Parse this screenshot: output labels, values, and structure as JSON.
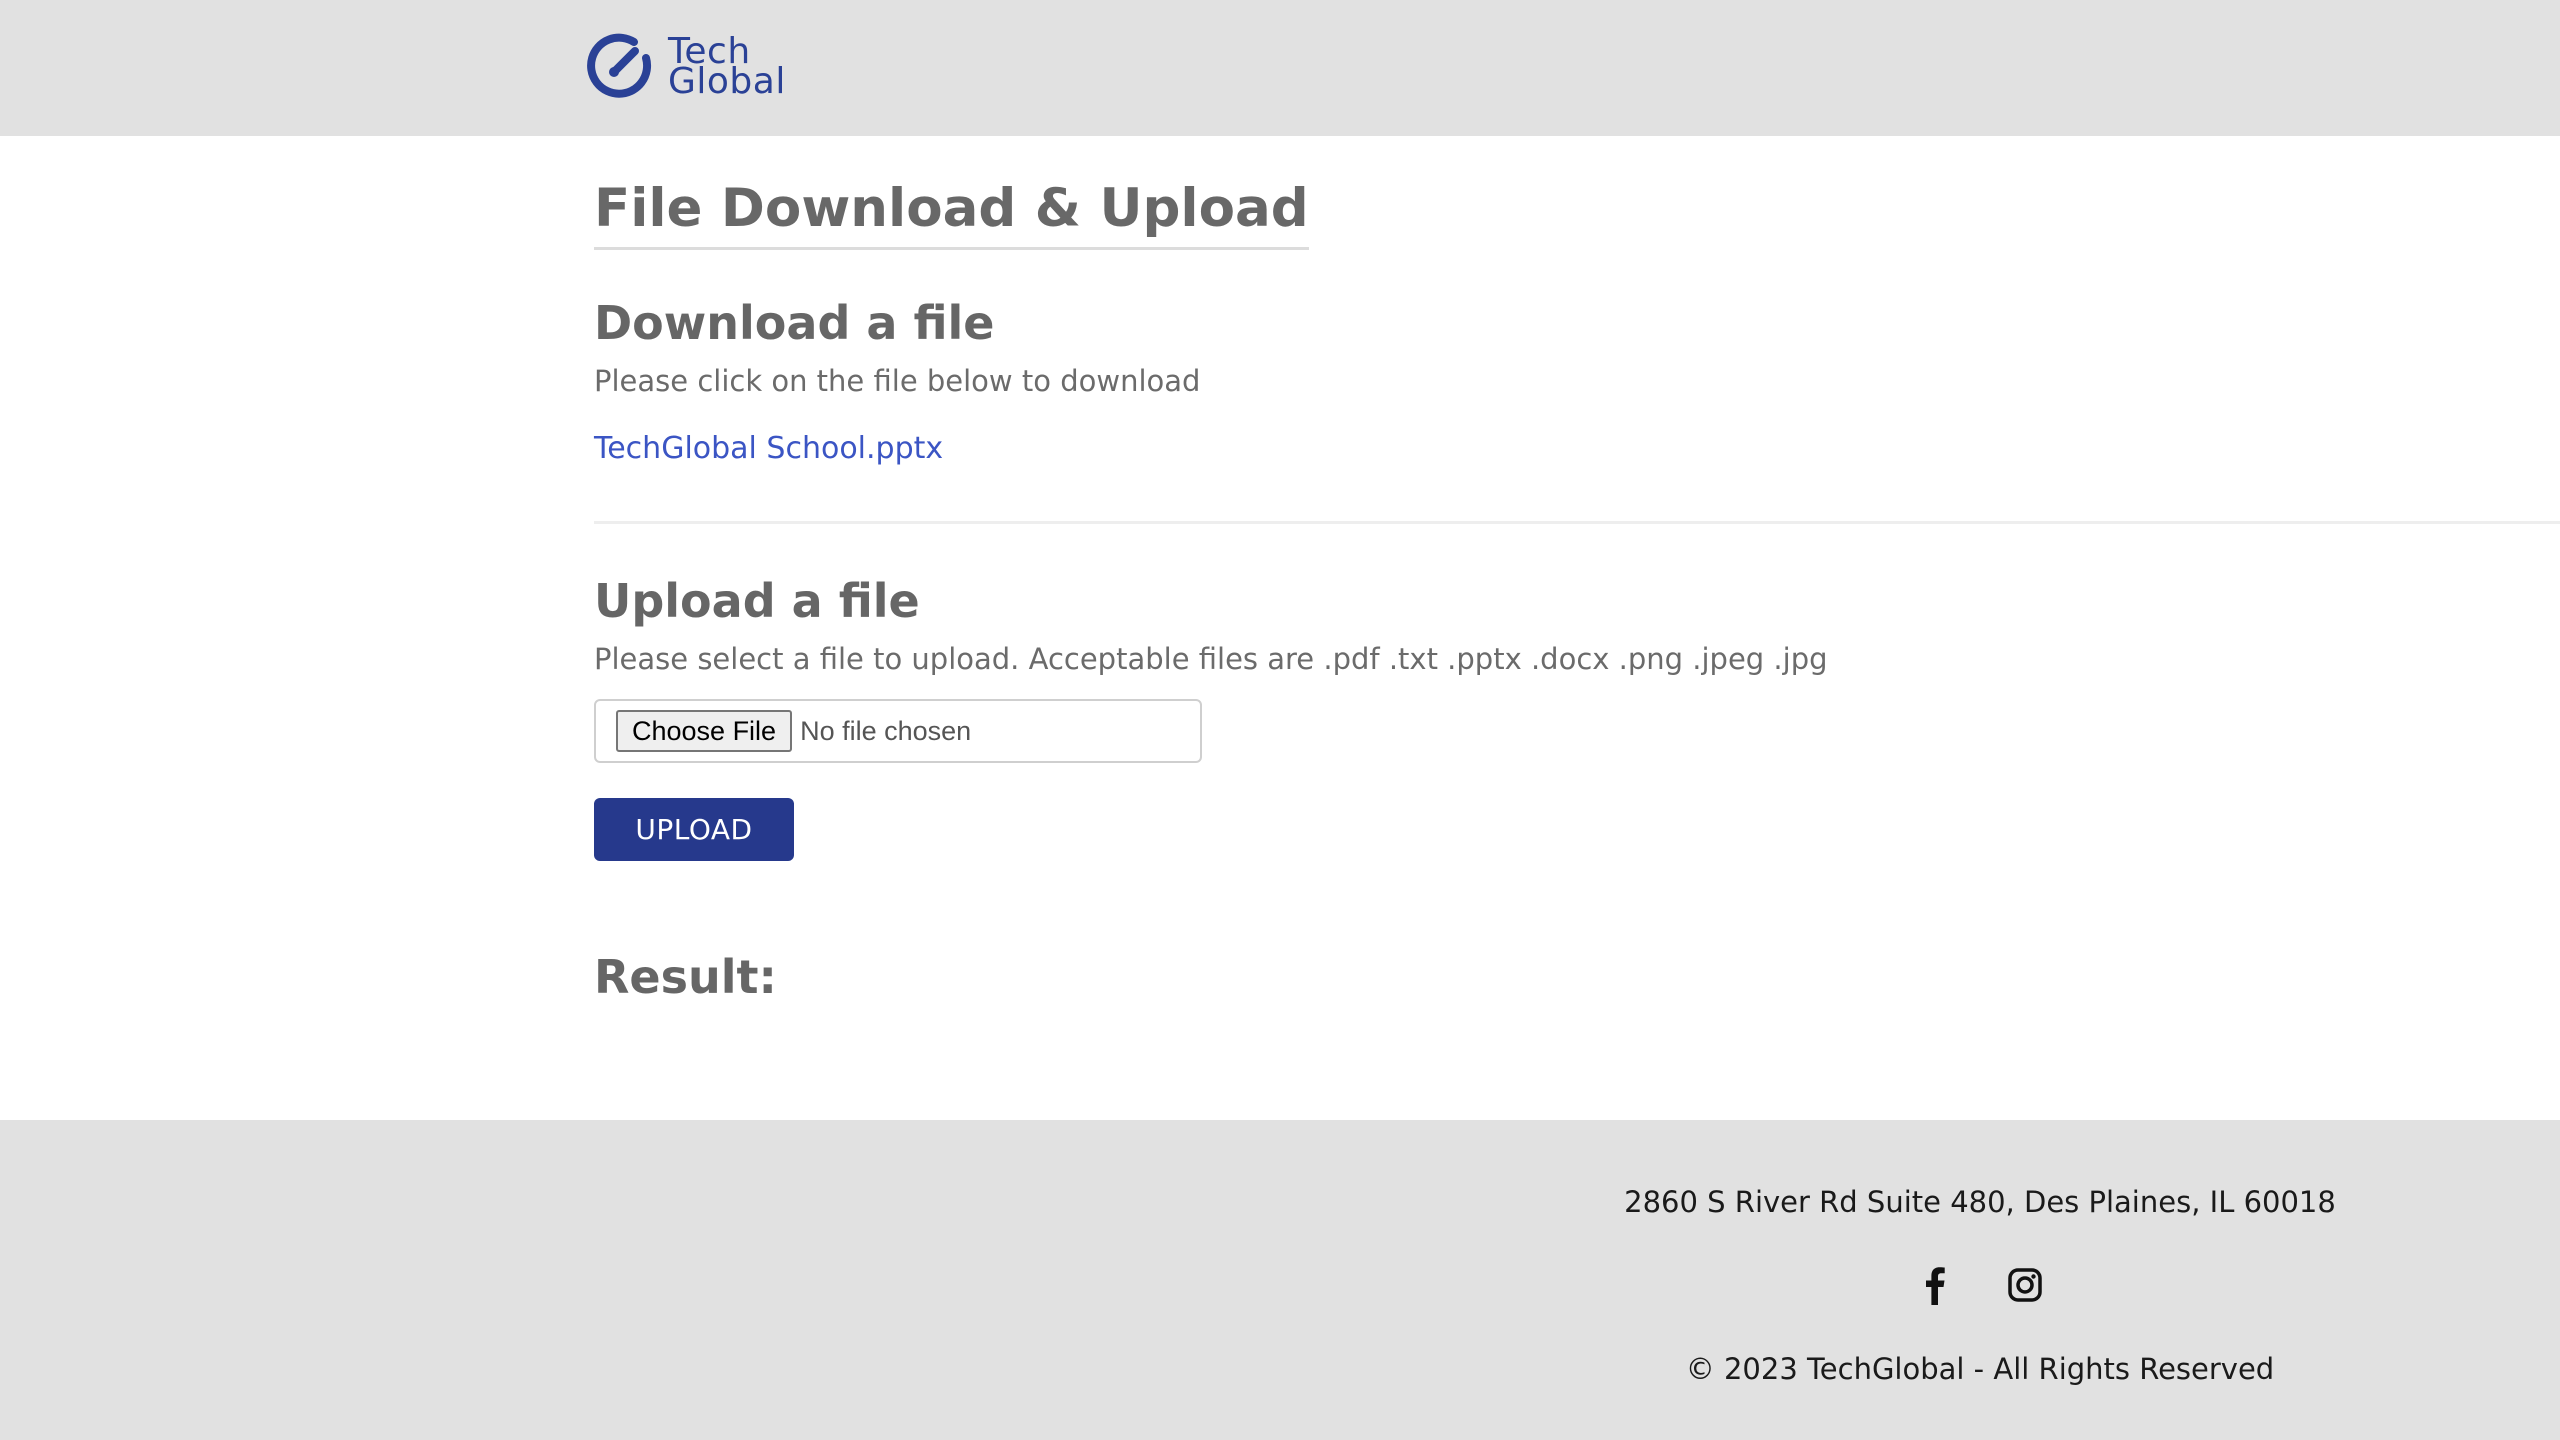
{
  "header": {
    "logo": {
      "line1": "Tech",
      "line2": "Global",
      "color": "#2a4196"
    }
  },
  "main": {
    "page_title": "File Download & Upload",
    "download": {
      "heading": "Download a file",
      "description": "Please click on the file below to download",
      "file_link": "TechGlobal School.pptx"
    },
    "upload": {
      "heading": "Upload a file",
      "description": "Please select a file to upload. Acceptable files are .pdf .txt .pptx .docx .png .jpeg .jpg",
      "choose_file_label": "Choose File",
      "no_file_text": "No file chosen",
      "upload_button": "UPLOAD"
    },
    "result_label": "Result:"
  },
  "footer": {
    "address": "2860 S River Rd Suite 480, Des Plaines, IL 60018",
    "social_icons": [
      "facebook-icon",
      "instagram-icon"
    ],
    "copyright": "© 2023 TechGlobal - All Rights Reserved"
  },
  "colors": {
    "accent": "#26398c",
    "link": "#3b55c4",
    "header_bg": "#e1e1e1",
    "footer_bg": "#e1e1e1"
  }
}
